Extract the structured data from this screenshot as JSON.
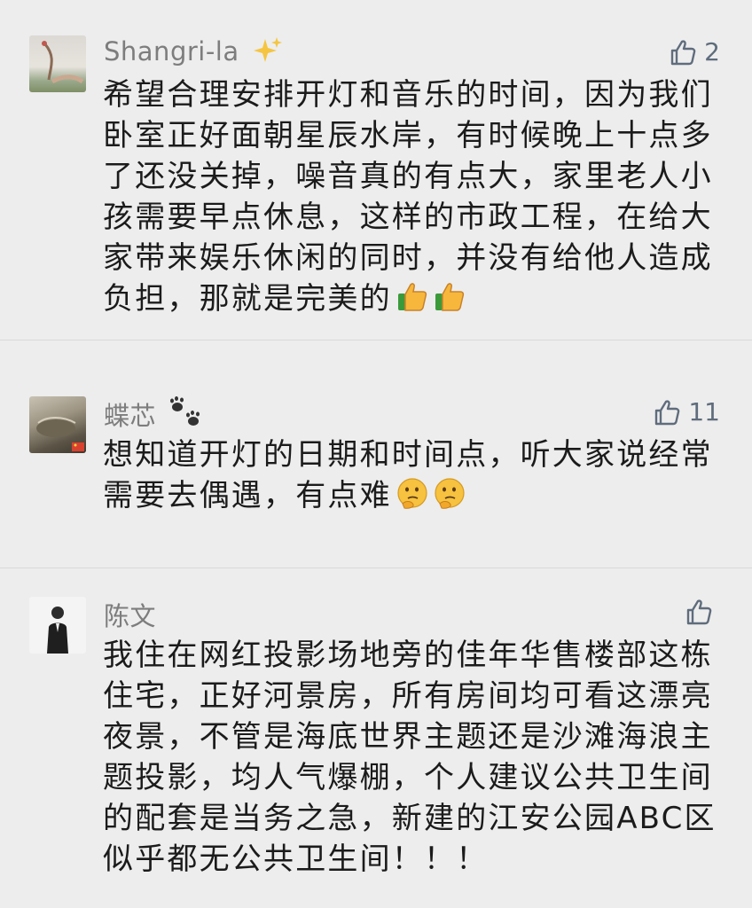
{
  "comments": [
    {
      "username": "Shangri-la",
      "likes": "2",
      "text": "希望合理安排开灯和音乐的时间，因为我们卧室正好面朝星辰水岸，有时候晚上十点多了还没关掉，噪音真的有点大，家里老人小孩需要早点休息，这样的市政工程，在给大家带来娱乐休闲的同时，并没有给他人造成负担，那就是完美的",
      "name_emoji": "sparkles-icon",
      "trailing_emoji": [
        "thumbs-up-emoji",
        "thumbs-up-emoji"
      ]
    },
    {
      "username": "蝶芯",
      "likes": "11",
      "text": "想知道开灯的日期和时间点，听大家说经常需要去偶遇，有点难",
      "name_emoji": "paw-prints-icon",
      "trailing_emoji": [
        "thinking-face-emoji",
        "thinking-face-emoji"
      ]
    },
    {
      "username": "陈文",
      "likes": "",
      "text": "我住在网红投影场地旁的佳年华售楼部这栋住宅，正好河景房，所有房间均可看这漂亮夜景，不管是海底世界主题还是沙滩海浪主题投影，均人气爆棚，个人建议公共卫生间的配套是当务之急，新建的江安公园ABC区似乎都无公共卫生间！！！"
    }
  ],
  "colors": {
    "background": "#ededed",
    "username": "#7d7d7d",
    "text": "#1b1b1b",
    "like_icon": "#5f6c7d"
  }
}
